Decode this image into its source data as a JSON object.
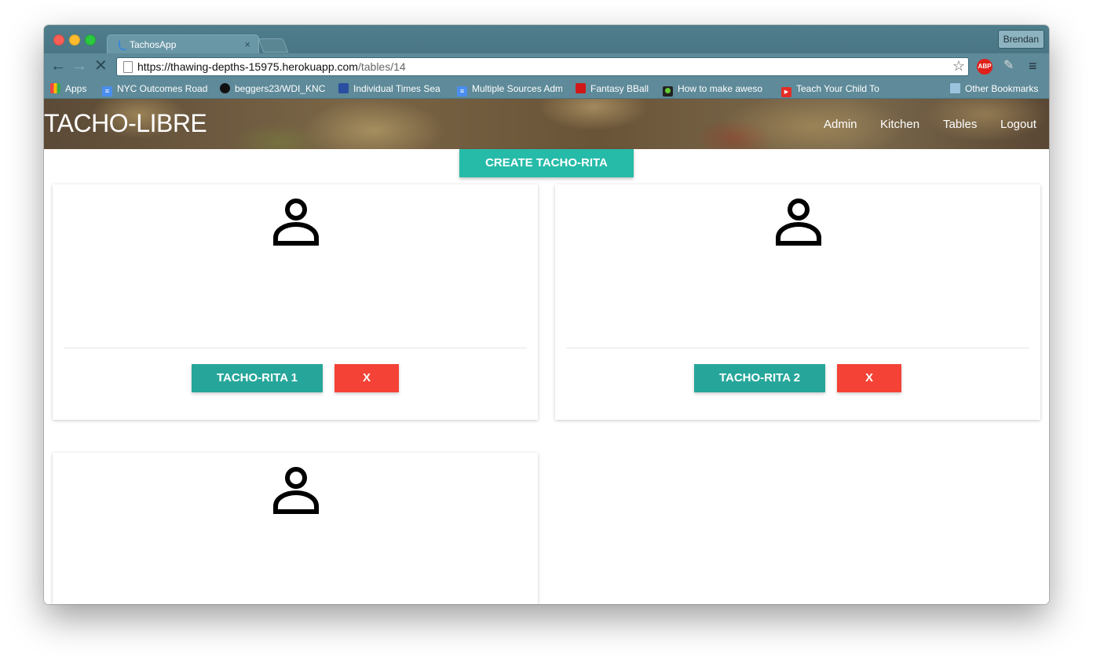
{
  "browser": {
    "tab_title": "TachosApp",
    "tab_close": "×",
    "profile": "Brendan",
    "url_host": "https://thawing-depths-15975.herokuapp.com",
    "url_path": "/tables/14",
    "abp": "ABP",
    "nav_back": "←",
    "nav_forward": "→",
    "nav_stop": "✕",
    "star": "☆",
    "menu": "≡"
  },
  "bookmarks": {
    "items": [
      {
        "label": "Apps",
        "icon": "apps-grid-icon"
      },
      {
        "label": "NYC Outcomes Road",
        "icon": "google-docs-icon"
      },
      {
        "label": "beggers23/WDI_KNC",
        "icon": "github-icon"
      },
      {
        "label": "Individual Times Sea",
        "icon": "usa-swimming-icon"
      },
      {
        "label": "Multiple Sources Adm",
        "icon": "google-docs-icon"
      },
      {
        "label": "Fantasy BBall",
        "icon": "espn-icon"
      },
      {
        "label": "How to make aweso",
        "icon": "green-dot-icon"
      },
      {
        "label": "Teach Your Child To",
        "icon": "youtube-icon"
      }
    ],
    "other": "Other Bookmarks"
  },
  "site": {
    "brand": "TACHO-LIBRE",
    "nav": [
      "Admin",
      "Kitchen",
      "Tables",
      "Logout"
    ]
  },
  "main": {
    "create_label": "CREATE TACHO-RITA",
    "cards": [
      {
        "button": "TACHO-RITA 1",
        "delete": "X"
      },
      {
        "button": "TACHO-RITA 2",
        "delete": "X"
      },
      {
        "button": "",
        "delete": ""
      }
    ]
  },
  "colors": {
    "create": "#26bba8",
    "tacho_button": "#26a69a",
    "delete_button": "#f44336"
  }
}
